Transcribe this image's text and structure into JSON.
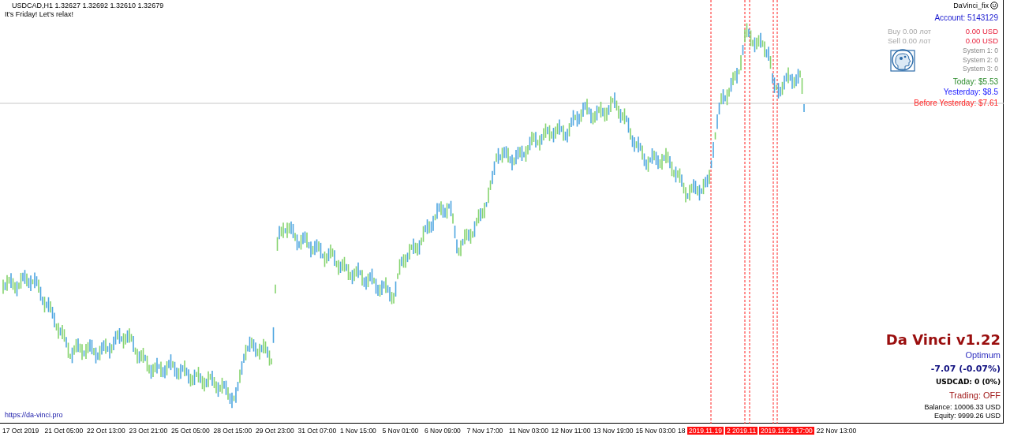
{
  "header": {
    "symbol_line": "USDCAD,H1  1.32627 1.32692 1.32610 1.32679",
    "message": "It's Friday! Let's relax!"
  },
  "expert": {
    "name": "DaVinci_fix"
  },
  "panel": {
    "account": "Account: 5143129",
    "buy_label": "Buy 0.00 лот",
    "buy_value": "0.00 USD",
    "sell_label": "Sell 0.00 лот",
    "sell_value": "0.00 USD",
    "systems": [
      "System 1: 0",
      "System 2: 0",
      "System 3: 0"
    ],
    "today": "Today: $5.53",
    "yesterday": "Yesterday: $8.5",
    "before_yesterday": "Before Yesterday: $7.61"
  },
  "footer": {
    "title": "Da Vinci v1.22",
    "mode": "Optimum",
    "profit": "-7.07 (-0.07%)",
    "symbol_result": "USDCAD: 0 (0%)",
    "trading": "Trading: OFF",
    "balance": "Balance: 10006.33 USD",
    "equity": "Equity: 9999.26 USD"
  },
  "link": "https://da-vinci.pro",
  "time_axis": [
    {
      "label": "17 Oct 2019",
      "kind": "time"
    },
    {
      "label": "21 Oct 05:00",
      "kind": "time"
    },
    {
      "label": "22 Oct 13:00",
      "kind": "time"
    },
    {
      "label": "23 Oct 21:00",
      "kind": "time"
    },
    {
      "label": "25 Oct 05:00",
      "kind": "time"
    },
    {
      "label": "28 Oct 15:00",
      "kind": "time"
    },
    {
      "label": "29 Oct 23:00",
      "kind": "time"
    },
    {
      "label": "31 Oct 07:00",
      "kind": "time"
    },
    {
      "label": "1 Nov 15:00",
      "kind": "time"
    },
    {
      "label": "5 Nov 01:00",
      "kind": "time"
    },
    {
      "label": "6 Nov 09:00",
      "kind": "time"
    },
    {
      "label": "7 Nov 17:00",
      "kind": "time"
    },
    {
      "label": "11 Nov 03:00",
      "kind": "time"
    },
    {
      "label": "12 Nov 11:00",
      "kind": "time"
    },
    {
      "label": "13 Nov 19:00",
      "kind": "time"
    },
    {
      "label": "15 Nov 03:00",
      "kind": "time"
    },
    {
      "label": "18",
      "kind": "cut"
    },
    {
      "label": "2019.11.19",
      "kind": "marker"
    },
    {
      "label": "2 2019.11",
      "kind": "marker"
    },
    {
      "label": "2019.11.21 17:00",
      "kind": "marker"
    },
    {
      "label": "22 Nov 13:00",
      "kind": "time"
    }
  ]
}
